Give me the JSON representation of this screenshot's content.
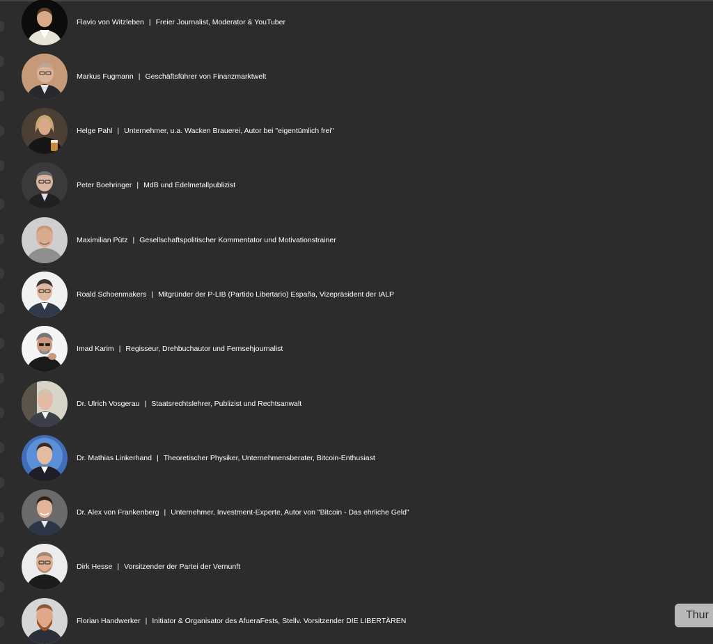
{
  "speakers": [
    {
      "name": "Flavio von Witzleben",
      "role": "Freier Journalist, Moderator & YouTuber",
      "photo": "flavio-von-witzleben-photo"
    },
    {
      "name": "Markus Fugmann",
      "role": "Geschäftsführer von Finanzmarktwelt",
      "photo": "markus-fugmann-photo"
    },
    {
      "name": "Helge Pahl",
      "role": "Unternehmer, u.a. Wacken Brauerei, Autor bei \"eigentümlich frei\"",
      "photo": "helge-pahl-photo"
    },
    {
      "name": "Peter Boehringer",
      "role": "MdB und Edelmetallpublizist",
      "photo": "peter-boehringer-photo"
    },
    {
      "name": "Maximilian Pütz",
      "role": "Gesellschaftspolitischer Kommentator und Motivationstrainer",
      "photo": "maximilian-puetz-photo"
    },
    {
      "name": "Roald Schoenmakers",
      "role": "Mitgründer der P-LIB (Partido Libertario) España, Vizepräsident der IALP",
      "photo": "roald-schoenmakers-photo"
    },
    {
      "name": "Imad Karim",
      "role": "Regisseur, Drehbuchautor und Fernsehjournalist",
      "photo": "imad-karim-photo"
    },
    {
      "name": "Dr. Ulrich Vosgerau",
      "role": "Staatsrechtslehrer, Publizist und Rechtsanwalt",
      "photo": "ulrich-vosgerau-photo"
    },
    {
      "name": "Dr. Mathias Linkerhand",
      "role": "Theoretischer Physiker, Unternehmensberater, Bitcoin-Enthusiast",
      "photo": "mathias-linkerhand-photo"
    },
    {
      "name": "Dr. Alex von Frankenberg",
      "role": "Unternehmer, Investment-Experte, Autor von \"Bitcoin - Das ehrliche Geld\"",
      "photo": "alex-von-frankenberg-photo"
    },
    {
      "name": "Dirk Hesse",
      "role": "Vorsitzender der Partei der Vernunft",
      "photo": "dirk-hesse-photo"
    },
    {
      "name": "Florian Handwerker",
      "role": "Initiator & Organisator des AfueraFests, Stellv. Vorsitzender DIE LIBERTÄREN",
      "photo": "florian-handwerker-photo"
    }
  ],
  "separator": "|",
  "side_button": {
    "label": "Thur"
  },
  "colors": {
    "background": "#2c2c2c",
    "text": "#ffffff",
    "side_button": "#b9b9b9"
  }
}
